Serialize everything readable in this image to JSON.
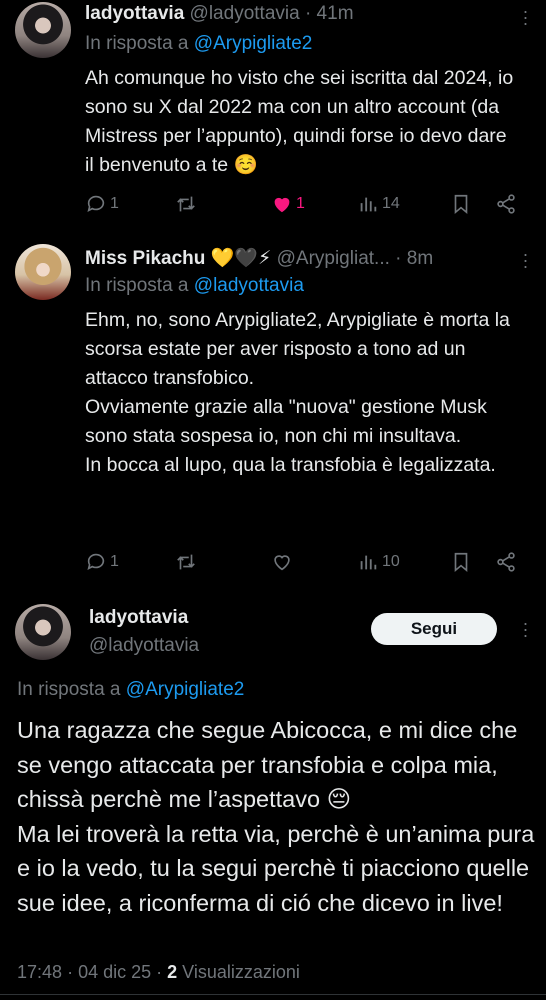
{
  "tweet1": {
    "name": "ladyottavia",
    "handle": "@ladyottavia",
    "time": "· 41m",
    "reply_prefix": "In risposta a",
    "reply_to": "@Arypigliate2",
    "text": "Ah comunque ho visto che sei iscritta dal 2024, io sono su X dal 2022 ma con un altro account (da Mistress per l’appunto), quindi forse io devo dare il benvenuto a te ☺️",
    "replies": "1",
    "likes": "1",
    "views": "14",
    "liked": true
  },
  "tweet2": {
    "name": "Miss Pikachu 💛🖤⚡",
    "handle": "@Arypigliat...",
    "time": "· 8m",
    "reply_prefix": "In risposta a",
    "reply_to": "@ladyottavia",
    "text": "Ehm, no, sono Arypigliate2, Arypigliate è morta la scorsa estate per aver risposto a tono ad un attacco transfobico.\nOvviamente grazie alla \"nuova\" gestione Musk sono stata sospesa io, non chi mi insultava.\nIn bocca al lupo, qua la transfobia è legalizzata.",
    "replies": "1",
    "views": "10"
  },
  "tweet3": {
    "name": "ladyottavia",
    "handle": "@ladyottavia",
    "follow_label": "Segui",
    "reply_prefix": "In risposta a",
    "reply_to": "@Arypigliate2",
    "text": "Una ragazza che segue Abicocca, e mi dice che se vengo attaccata per transfobia e colpa mia, chissà perchè me l’aspettavo 😔\nMa lei troverà la retta via, perchè è un’anima pura e io la vedo, tu la segui perchè ti piacciono quelle sue idee, a riconferma di ció che dicevo in live!",
    "time": "17:48",
    "date": "04 dic 25",
    "views_count": "2",
    "views_label": "Visualizzazioni"
  },
  "colors": {
    "background": "#000000",
    "text": "#e7e9ea",
    "muted": "#71767b",
    "link": "#1d9bf0",
    "like": "#f91880"
  },
  "icons": [
    "reply-icon",
    "retweet-icon",
    "heart-icon",
    "views-icon",
    "bookmark-icon",
    "share-icon",
    "more-icon"
  ]
}
